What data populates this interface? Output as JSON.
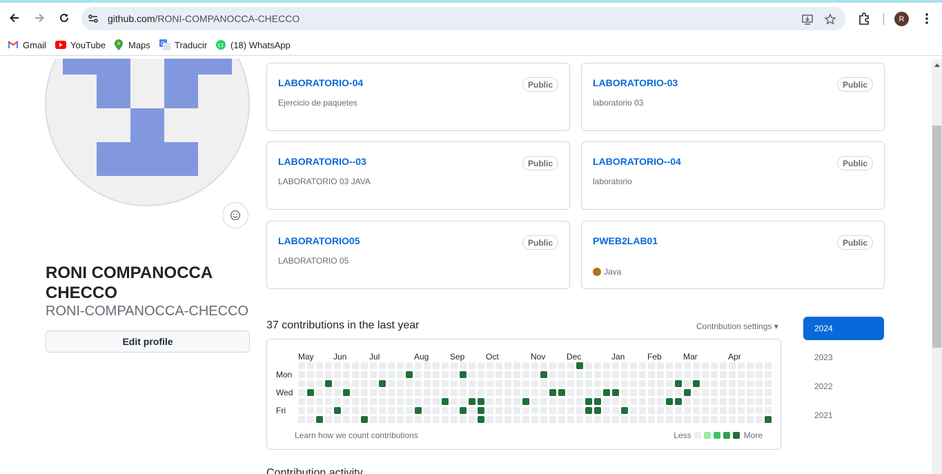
{
  "browser": {
    "url_host": "github.com",
    "url_path": "/RONI-COMPANOCCA-CHECCO",
    "profile_initial": "R"
  },
  "bookmarks": [
    {
      "label": "Gmail",
      "icon": "gmail-icon"
    },
    {
      "label": "YouTube",
      "icon": "youtube-icon"
    },
    {
      "label": "Maps",
      "icon": "maps-icon"
    },
    {
      "label": "Traducir",
      "icon": "translate-icon"
    },
    {
      "label": "(18) WhatsApp",
      "icon": "whatsapp-icon",
      "badge": "12"
    }
  ],
  "profile": {
    "full_name": "RONI COMPANOCCA CHECCO",
    "username": "RONI-COMPANOCCA-CHECCO",
    "edit_button": "Edit profile"
  },
  "repos": [
    {
      "name": "LABORATORIO-04",
      "visibility": "Public",
      "description": "Ejercicio de paquetes"
    },
    {
      "name": "LABORATORIO-03",
      "visibility": "Public",
      "description": "laboratorio 03"
    },
    {
      "name": "LABORATORIO--03",
      "visibility": "Public",
      "description": "LABORATORIO 03 JAVA"
    },
    {
      "name": "LABORATORIO--04",
      "visibility": "Public",
      "description": "laboratorio"
    },
    {
      "name": "LABORATORIO05",
      "visibility": "Public",
      "description": "LABORATORIO 05"
    },
    {
      "name": "PWEB2LAB01",
      "visibility": "Public",
      "language": "Java",
      "language_color": "#b07219"
    }
  ],
  "contributions": {
    "title": "37 contributions in the last year",
    "settings_label": "Contribution settings ▾",
    "months": [
      "May",
      "Jun",
      "Jul",
      "Aug",
      "Sep",
      "Oct",
      "Nov",
      "Dec",
      "Jan",
      "Feb",
      "Mar",
      "Apr"
    ],
    "day_labels": [
      "Mon",
      "Wed",
      "Fri"
    ],
    "learn_text": "Learn how we count contributions",
    "legend_less": "Less",
    "legend_more": "More",
    "level_colors": [
      "#ebedf0",
      "#9be9a8",
      "#40c463",
      "#30a14e",
      "#216e39"
    ]
  },
  "years": [
    "2024",
    "2023",
    "2022",
    "2021"
  ],
  "activity_title": "Contribution activity"
}
